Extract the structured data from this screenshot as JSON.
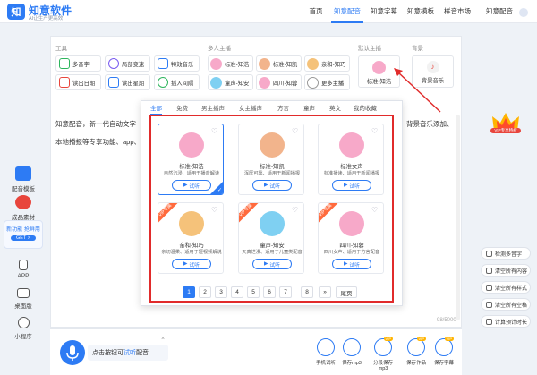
{
  "header": {
    "brand": "知意软件",
    "slogan": "AI让生产更高效",
    "nav": [
      "首页",
      "知意配音",
      "知意字幕",
      "知意模板",
      "样音市场",
      "知意配音"
    ],
    "active_nav": 1
  },
  "left_sidebar": {
    "items": [
      "配音模板",
      "成品素材",
      "新功能 抢鲜用",
      "GET >",
      "APP",
      "桌面版",
      "小程序"
    ]
  },
  "tools": {
    "label": "工具",
    "items": [
      "多音字",
      "局部变速",
      "特效音乐",
      "读出日期",
      "读出星期",
      "插入间隔"
    ]
  },
  "hosts": {
    "label": "多人主播",
    "items": [
      "标准-知浩",
      "标准-知凯",
      "亲和-知巧",
      "童声-知安",
      "四川-知蓉",
      "更多主播"
    ]
  },
  "default_host": {
    "label": "默认主播",
    "name": "标准-知浩"
  },
  "bgm": {
    "label": "背景",
    "name": "背景音乐"
  },
  "editor": {
    "line1": "知意配音，新一代自动文字",
    "line1_tail": "背景音乐添加、",
    "line2": "本地播报等专享功能、app、",
    "counter": "98/5000"
  },
  "popup": {
    "tabs": [
      "全部",
      "免费",
      "男主播声",
      "女主播声",
      "方言",
      "童声",
      "英文",
      "我的收藏"
    ],
    "active_tab": 0,
    "cards": [
      {
        "name": "标准-知浩",
        "desc": "自然沉浸、适用于播音解读",
        "btn": "试听",
        "vip": "",
        "selected": true,
        "face": "#f7a9c9"
      },
      {
        "name": "标准-知凯",
        "desc": "浑厚可靠、适用于新闻播报",
        "btn": "试听",
        "vip": "",
        "selected": false,
        "face": "#f2b48c"
      },
      {
        "name": "标准女声",
        "desc": "标准播读、适用于新闻播报",
        "btn": "试听",
        "vip": "",
        "selected": false,
        "face": "#f7a9c9"
      },
      {
        "name": "亲和-知巧",
        "desc": "亲切温柔、适用于短视频解说",
        "btn": "试听",
        "vip": "VIP专属",
        "selected": false,
        "face": "#f5c27a"
      },
      {
        "name": "童声-知安",
        "desc": "天真烂漫、适用于儿童类配音",
        "btn": "试听",
        "vip": "VIP专属",
        "selected": false,
        "face": "#7fd0f2"
      },
      {
        "name": "四川-知蓉",
        "desc": "四川女声、适用于方言配音",
        "btn": "试听",
        "vip": "VIP专属",
        "selected": false,
        "face": "#f7a9c9"
      }
    ],
    "pages": [
      "1",
      "2",
      "3",
      "4",
      "5",
      "6",
      "7",
      "8",
      "»",
      "尾页"
    ],
    "active_page": 0
  },
  "right_side": {
    "vip_badge": "VIP专享特权",
    "buttons": [
      "检测多音字",
      "清空所有内容",
      "清空所有样式",
      "清空所有空格",
      "计算预计时长"
    ]
  },
  "bottom": {
    "mic_hint_pre": "点击按钮可",
    "mic_hint_link": "试听",
    "mic_hint_post": "配音...",
    "actions": [
      {
        "label": "手机试听",
        "vip": false
      },
      {
        "label": "保存mp3",
        "vip": false
      },
      {
        "label": "分段保存mp3",
        "vip": true
      },
      {
        "label": "保存作品",
        "vip": true
      },
      {
        "label": "保存字幕",
        "vip": true
      }
    ]
  },
  "colors": {
    "accent": "#2d7bf4",
    "highlight": "#e12b2b",
    "vip": "#ff6a3d"
  }
}
